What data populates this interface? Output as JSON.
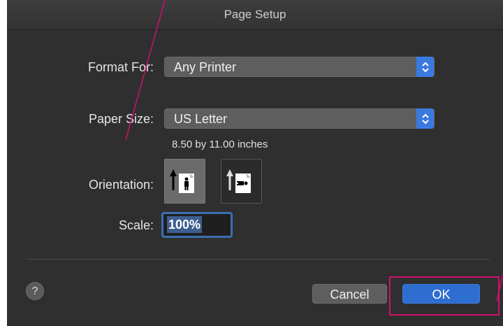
{
  "window": {
    "title": "Page Setup"
  },
  "format_for": {
    "label": "Format For:",
    "value": "Any Printer"
  },
  "paper_size": {
    "label": "Paper Size:",
    "value": "US Letter",
    "dimensions": "8.50 by 11.00 inches"
  },
  "orientation": {
    "label": "Orientation:",
    "options": [
      "portrait",
      "landscape"
    ],
    "selected": "portrait"
  },
  "scale": {
    "label": "Scale:",
    "value": "100%"
  },
  "buttons": {
    "help": "?",
    "cancel": "Cancel",
    "ok": "OK"
  },
  "colors": {
    "accent": "#2f6ed1",
    "annotation": "#d0106f",
    "dialog_bg": "#2f2f2f"
  }
}
